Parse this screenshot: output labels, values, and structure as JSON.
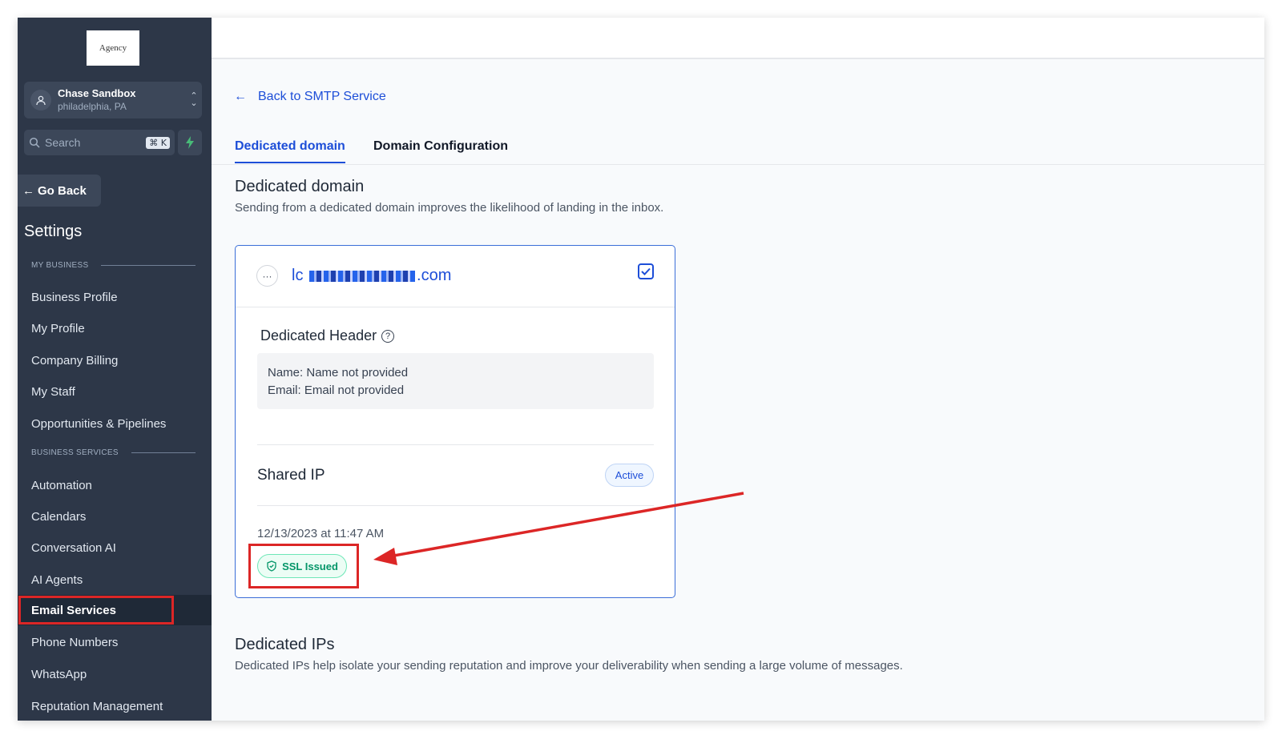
{
  "logo": {
    "text": "Agency"
  },
  "account": {
    "name": "Chase Sandbox",
    "location": "philadelphia, PA"
  },
  "search": {
    "placeholder": "Search",
    "shortcut": "⌘ K"
  },
  "sidebar": {
    "go_back": "Go Back",
    "title": "Settings",
    "sections": [
      {
        "label": "MY BUSINESS"
      },
      {
        "label": "BUSINESS SERVICES"
      }
    ],
    "items": [
      {
        "label": "Business Profile"
      },
      {
        "label": "My Profile"
      },
      {
        "label": "Company Billing"
      },
      {
        "label": "My Staff"
      },
      {
        "label": "Opportunities & Pipelines"
      },
      {
        "label": "Automation"
      },
      {
        "label": "Calendars"
      },
      {
        "label": "Conversation AI"
      },
      {
        "label": "AI Agents"
      },
      {
        "label": "Email Services"
      },
      {
        "label": "Phone Numbers"
      },
      {
        "label": "WhatsApp"
      },
      {
        "label": "Reputation Management"
      }
    ]
  },
  "main": {
    "back_link": "Back to SMTP Service",
    "tabs": [
      {
        "label": "Dedicated domain"
      },
      {
        "label": "Domain Configuration"
      }
    ],
    "section1": {
      "title": "Dedicated domain",
      "description": "Sending from a dedicated domain improves the likelihood of landing in the inbox."
    },
    "card": {
      "more": "···",
      "domain_prefix": "lc",
      "domain_suffix": ".com",
      "dedicated_header": "Dedicated Header",
      "name_label": "Name:",
      "name_value": "Name not provided",
      "email_label": "Email:",
      "email_value": "Email not provided",
      "shared_ip": "Shared IP",
      "status": "Active",
      "date": "12/13/2023 at 11:47 AM",
      "ssl": "SSL Issued"
    },
    "section2": {
      "title": "Dedicated IPs",
      "description": "Dedicated IPs help isolate your sending reputation and improve your deliverability when sending a large volume of messages."
    }
  },
  "colors": {
    "accent": "#1d4ed8",
    "sidebar": "#2d3748",
    "annotation": "#dc2626",
    "success": "#059669"
  }
}
